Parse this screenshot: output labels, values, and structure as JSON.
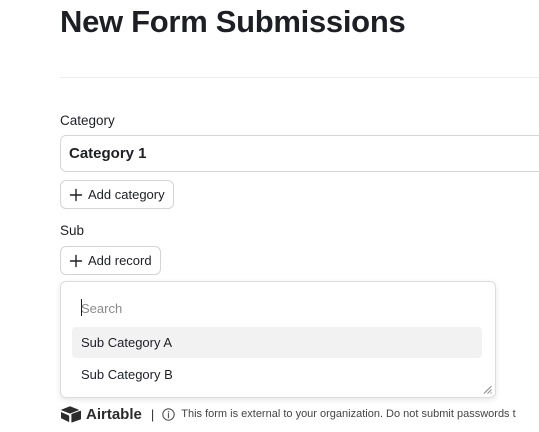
{
  "header": {
    "title": "New Form Submissions"
  },
  "category": {
    "label": "Category",
    "value": "Category 1",
    "add_label": "Add category"
  },
  "sub": {
    "label": "Sub",
    "add_label": "Add record"
  },
  "dropdown": {
    "search_placeholder": "Search",
    "options": [
      {
        "label": "Sub Category A",
        "highlighted": true
      },
      {
        "label": "Sub Category B",
        "highlighted": false
      }
    ]
  },
  "footer": {
    "brand": "Airtable",
    "separator": "|",
    "notice": "This form is external to your organization. Do not submit passwords t"
  },
  "colors": {
    "text": "#1d1f25",
    "border": "#d6d6d6",
    "highlight": "#f2f2f2"
  },
  "icons": {
    "add": "plus-icon",
    "info": "info-icon",
    "brand": "airtable-logo-icon"
  }
}
